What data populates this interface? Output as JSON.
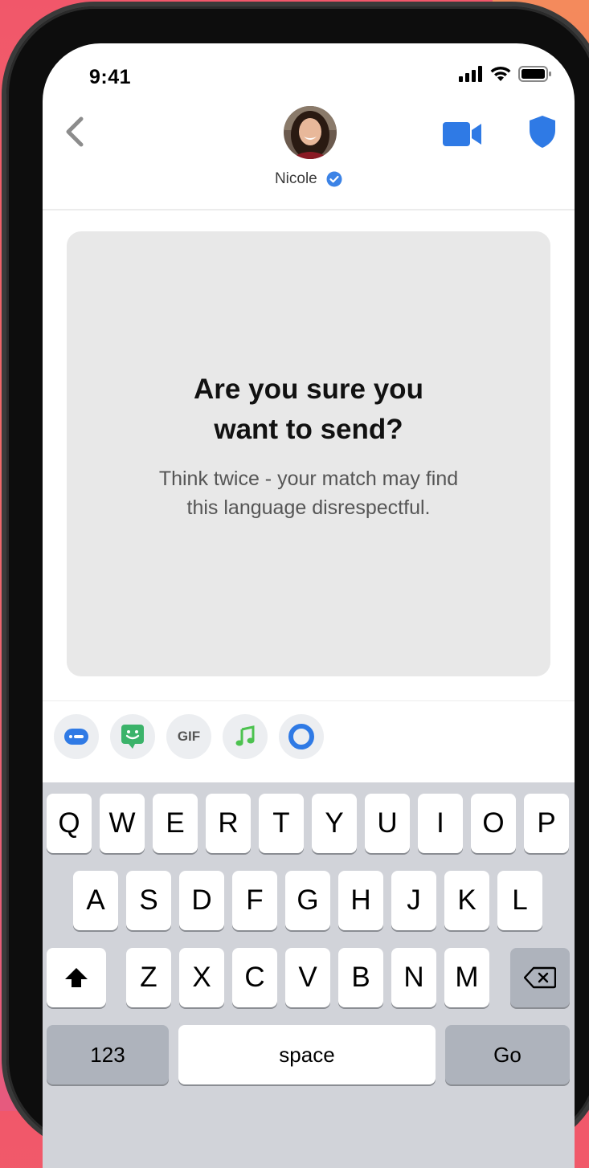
{
  "status_bar": {
    "time": "9:41"
  },
  "contact": {
    "name": "Nicole"
  },
  "card": {
    "title_line1": "Are you sure you",
    "title_line2": "want to send?",
    "body_line1": "Think twice - your match may find",
    "body_line2": "this language disrespectful."
  },
  "toolbar": {
    "gif_label": "GIF"
  },
  "keyboard": {
    "row1": [
      "Q",
      "W",
      "E",
      "R",
      "T",
      "Y",
      "U",
      "I",
      "O",
      "P"
    ],
    "row2": [
      "A",
      "S",
      "D",
      "F",
      "G",
      "H",
      "J",
      "K",
      "L"
    ],
    "row3": [
      "Z",
      "X",
      "C",
      "V",
      "B",
      "N",
      "M"
    ],
    "numbers_label": "123",
    "space_label": "space",
    "go_label": "Go"
  },
  "colors": {
    "accent_blue": "#2f7ae5",
    "verified_blue": "#3c83e6",
    "keyboard_bg": "#d1d3d9"
  },
  "icons": [
    "back-chevron-icon",
    "video-call-icon",
    "shield-icon",
    "verified-badge-icon",
    "message-icon",
    "sticker-icon",
    "music-icon",
    "ring-icon",
    "shift-icon",
    "backspace-icon"
  ]
}
